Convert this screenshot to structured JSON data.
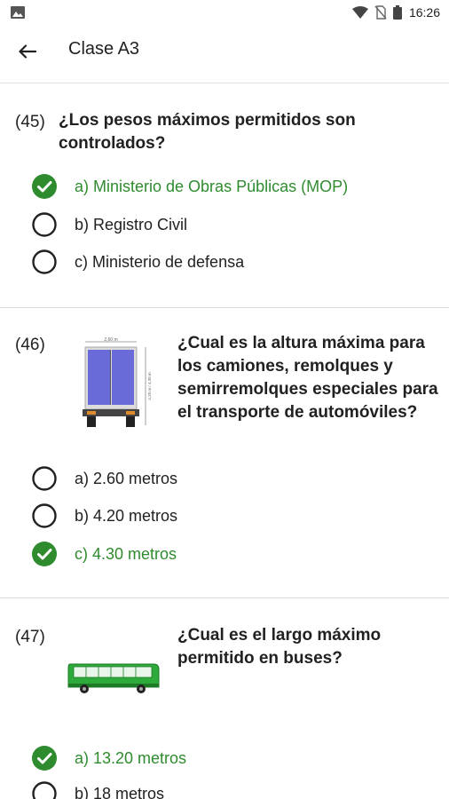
{
  "status_bar": {
    "time": "16:26",
    "icons": [
      "gallery-icon",
      "wifi-icon",
      "no-sim-icon",
      "battery-icon"
    ]
  },
  "app_bar": {
    "title": "Clase A3",
    "back_icon": "arrow-back-icon"
  },
  "colors": {
    "correct": "#2e8b2e",
    "text": "#212121",
    "divider": "#dcdcdc"
  },
  "questions": [
    {
      "number": "(45)",
      "text": "¿Los pesos máximos permitidos son controlados?",
      "image": null,
      "options": [
        {
          "label": "a) Ministerio de Obras Públicas (MOP)",
          "correct": true
        },
        {
          "label": "b) Registro Civil",
          "correct": false
        },
        {
          "label": "c) Ministerio de defensa",
          "correct": false
        }
      ]
    },
    {
      "number": "(46)",
      "text": "¿Cual es la altura máxima para los camiones, remolques y semirremolques especiales para el transporte de automóviles?",
      "image": "truck-rear-diagram",
      "image_labels": {
        "width": "2,60 m",
        "height": "4,20 m / 4,30 m"
      },
      "options": [
        {
          "label": "a) 2.60 metros",
          "correct": false
        },
        {
          "label": "b) 4.20 metros",
          "correct": false
        },
        {
          "label": "c) 4.30 metros",
          "correct": true
        }
      ]
    },
    {
      "number": "(47)",
      "text": "¿Cual es el largo máximo permitido en buses?",
      "image": "bus-illustration",
      "options": [
        {
          "label": "a) 13.20 metros",
          "correct": true
        },
        {
          "label": "b) 18 metros",
          "correct": false
        }
      ]
    }
  ]
}
